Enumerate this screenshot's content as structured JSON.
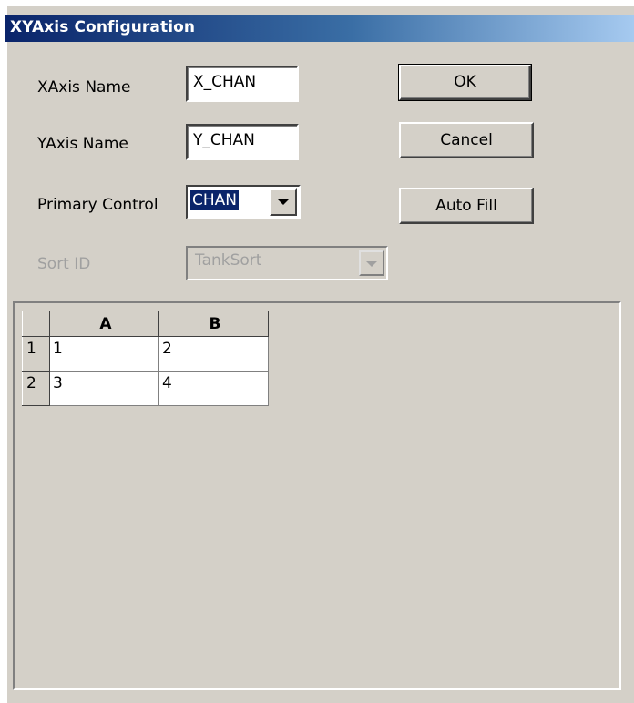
{
  "window": {
    "title": "XYAxis Configuration"
  },
  "form": {
    "xaxis_label": "XAxis Name",
    "xaxis_value": "X_CHAN",
    "yaxis_label": "YAxis Name",
    "yaxis_value": "Y_CHAN",
    "primary_label": "Primary Control",
    "primary_value": "CHAN",
    "sort_label": "Sort ID",
    "sort_value": "TankSort"
  },
  "buttons": {
    "ok": "OK",
    "cancel": "Cancel",
    "autofill": "Auto Fill"
  },
  "grid": {
    "columns": [
      "A",
      "B"
    ],
    "rows": [
      {
        "header": "1",
        "cells": [
          "1",
          "2"
        ]
      },
      {
        "header": "2",
        "cells": [
          "3",
          "4"
        ]
      }
    ]
  },
  "icons": {
    "dropdown": "chevron-down-icon"
  }
}
